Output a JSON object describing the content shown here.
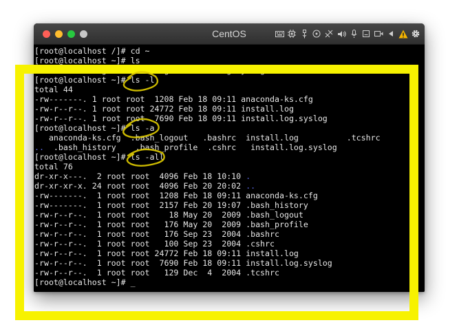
{
  "window": {
    "title": "CentOS",
    "traffic_lights": [
      {
        "name": "close-button",
        "color": "#ff5f57"
      },
      {
        "name": "minimize-button",
        "color": "#ffbd2e"
      },
      {
        "name": "maximize-button",
        "color": "#28c940"
      },
      {
        "name": "extra-button",
        "color": "#c8c8c8"
      }
    ],
    "toolbar_icons": [
      "keyboard-icon",
      "cpu-icon",
      "usb-icon",
      "cdrom-icon",
      "network-icon",
      "sound-icon",
      "microphone-icon",
      "printer-icon",
      "camera-icon",
      "arrow-left-icon",
      "warning-icon",
      "gear-icon"
    ]
  },
  "terminal": {
    "lines": [
      "[root@localhost /]# cd ~",
      "[root@localhost ~]# ls",
      "anaconda-ks.cfg  install.log  install.log.syslog",
      "[root@localhost ~]# ls -l",
      "total 44",
      "-rw-------. 1 root root  1208 Feb 18 09:11 anaconda-ks.cfg",
      "-rw-r--r--. 1 root root 24772 Feb 18 09:11 install.log",
      "-rw-r--r--. 1 root root  7690 Feb 18 09:11 install.log.syslog",
      "[root@localhost ~]# ls -a",
      "   anaconda-ks.cfg  .bash_logout   .bashrc  install.log          .tcshrc",
      "..  .bash_history    .bash_profile  .cshrc   install.log.syslog",
      "[root@localhost ~]# ls -all",
      "total 76",
      "dr-xr-x---.  2 root root  4096 Feb 18 10:10 .",
      "dr-xr-xr-x. 24 root root  4096 Feb 20 20:02 ..",
      "-rw-------.  1 root root  1208 Feb 18 09:11 anaconda-ks.cfg",
      "-rw-------.  1 root root  2157 Feb 20 19:07 .bash_history",
      "-rw-r--r--.  1 root root    18 May 20  2009 .bash_logout",
      "-rw-r--r--.  1 root root   176 May 20  2009 .bash_profile",
      "-rw-r--r--.  1 root root   176 Sep 23  2004 .bashrc",
      "-rw-r--r--.  1 root root   100 Sep 23  2004 .cshrc",
      "-rw-r--r--.  1 root root 24772 Feb 18 09:11 install.log",
      "-rw-r--r--.  1 root root  7690 Feb 18 09:11 install.log.syslog",
      "-rw-r--r--.  1 root root   129 Dec  4  2004 .tcshrc",
      "[root@localhost ~]# _"
    ]
  },
  "colors": {
    "highlight_frame": "#f7f200",
    "annotation_ink": "#e0cc00",
    "directory_text": "#5c6ae8",
    "terminal_text": "#e8e8e8",
    "terminal_bg": "#000000"
  }
}
